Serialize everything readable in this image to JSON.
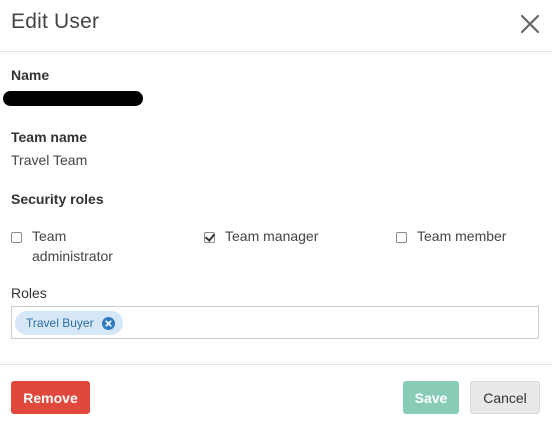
{
  "header": {
    "title": "Edit User"
  },
  "fields": {
    "name_label": "Name",
    "team_name_label": "Team name",
    "team_name_value": "Travel Team",
    "security_roles_label": "Security roles",
    "roles_label": "Roles"
  },
  "security_roles": [
    {
      "label_line1": "Team",
      "label_line2": "administrator",
      "checked": false
    },
    {
      "label_line1": "Team manager",
      "label_line2": "",
      "checked": true
    },
    {
      "label_line1": "Team member",
      "label_line2": "",
      "checked": false
    }
  ],
  "roles": {
    "tags": [
      {
        "label": "Travel Buyer"
      }
    ]
  },
  "footer": {
    "remove_label": "Remove",
    "save_label": "Save",
    "cancel_label": "Cancel"
  },
  "colors": {
    "remove": "#e0483b",
    "save": "#88cbb6",
    "tag_bg": "#d6e8f7",
    "tag_text": "#2d6ea6"
  },
  "icons": {
    "close": "close-icon",
    "tag_remove": "remove-tag-icon"
  }
}
